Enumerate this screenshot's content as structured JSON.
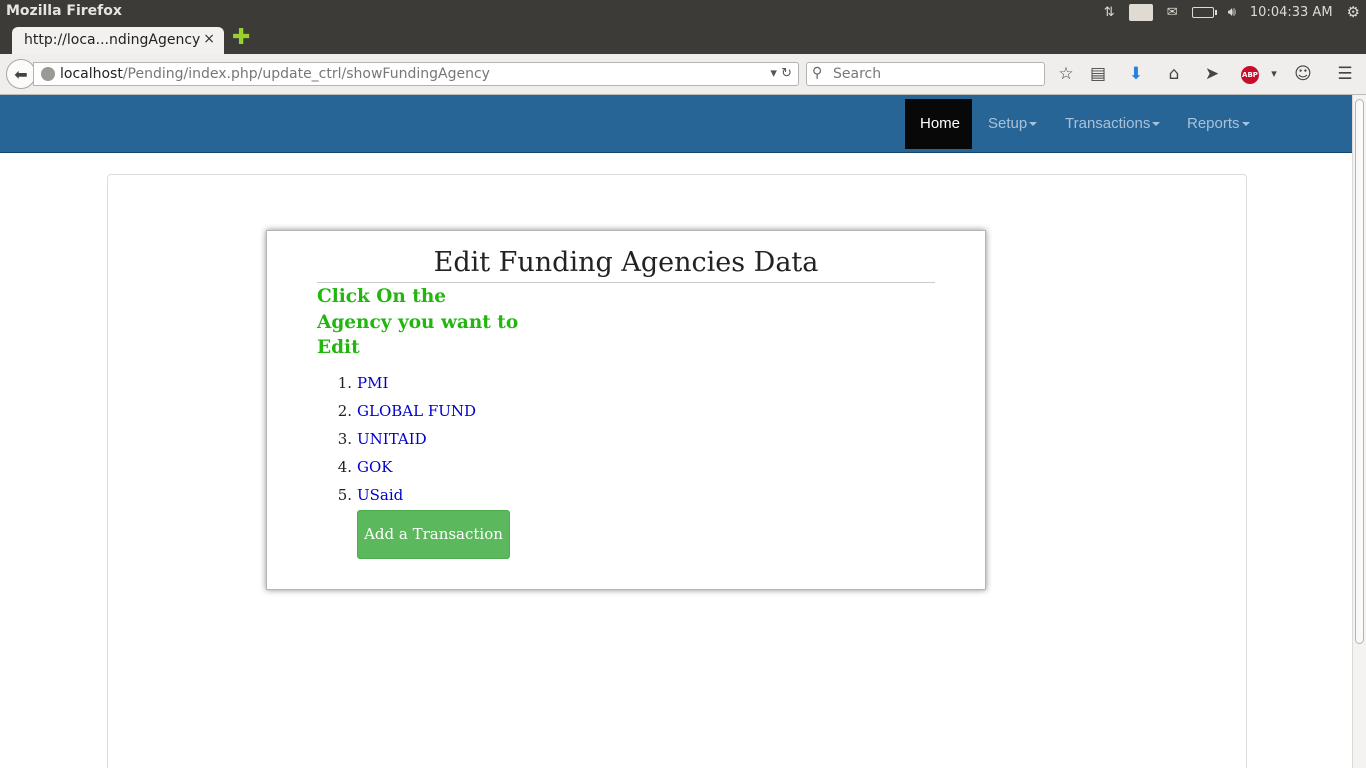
{
  "os": {
    "app_title": "Mozilla Firefox",
    "lang": "En",
    "clock": "10:04:33 AM"
  },
  "browser": {
    "tab_title": "http://loca...ndingAgency",
    "tab_close": "×",
    "new_tab": "✚",
    "url_host": "localhost",
    "url_path": "/Pending/index.php/update_ctrl/showFundingAgency",
    "search_placeholder": "Search",
    "abp_label": "ABP"
  },
  "site_nav": {
    "items": [
      {
        "label": "Home"
      },
      {
        "label": "Setup"
      },
      {
        "label": "Transactions"
      },
      {
        "label": "Reports"
      }
    ]
  },
  "main": {
    "title": "Edit Funding Agencies Data",
    "instruction": "Click On the Agency you want to Edit",
    "agencies": [
      {
        "num": "1.",
        "name": "PMI"
      },
      {
        "num": "2.",
        "name": "GLOBAL FUND"
      },
      {
        "num": "3.",
        "name": "UNITAID"
      },
      {
        "num": "4.",
        "name": "GOK"
      },
      {
        "num": "5.",
        "name": "USaid"
      }
    ],
    "add_button": "Add a Transaction"
  },
  "colors": {
    "site_nav_bg": "#286597",
    "instruction_green": "#22b60f",
    "link_blue": "#0000cc",
    "button_green": "#5cb85c"
  }
}
